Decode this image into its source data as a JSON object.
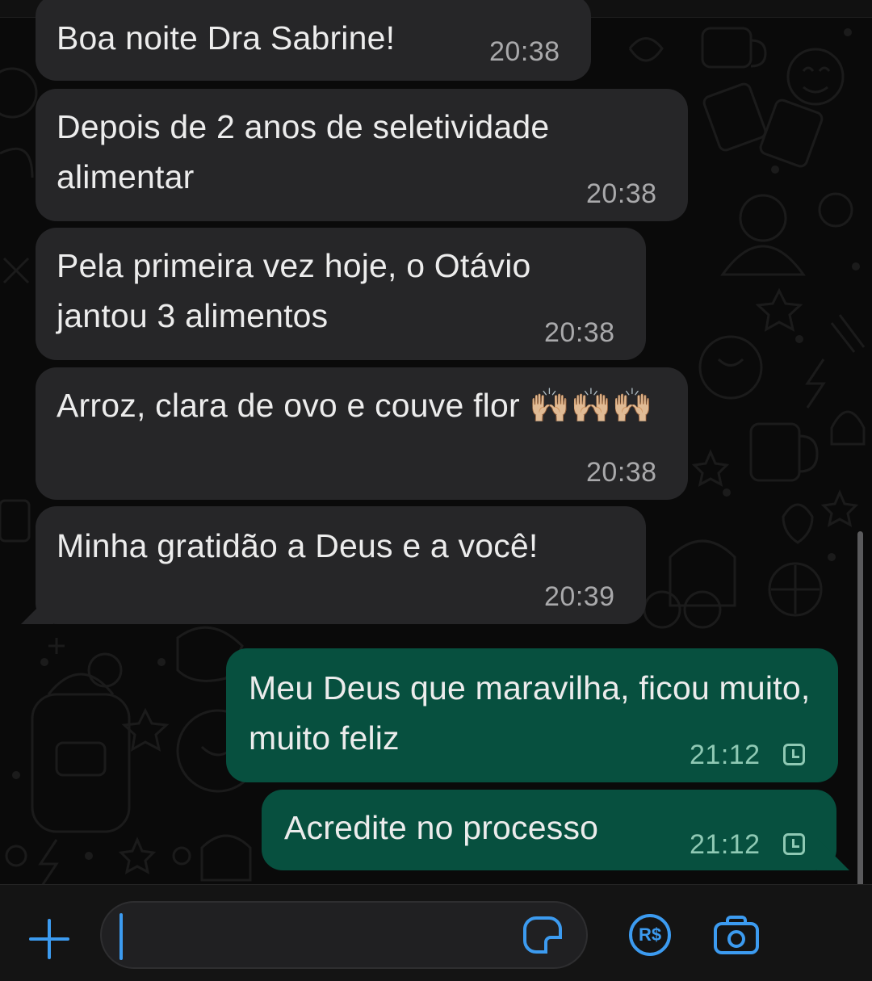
{
  "messages": [
    {
      "direction": "in",
      "text": "Boa noite Dra Sabrine!",
      "time": "20:38"
    },
    {
      "direction": "in",
      "text": "Depois de 2 anos de seletividade alimentar",
      "time": "20:38"
    },
    {
      "direction": "in",
      "text": "Pela primeira vez hoje, o Otávio jantou 3 alimentos",
      "time": "20:38"
    },
    {
      "direction": "in",
      "text": "Arroz, clara de ovo e couve flor 🙌🏼🙌🏼🙌🏼",
      "time": "20:38"
    },
    {
      "direction": "in",
      "text": "Minha gratidão a Deus e a você!",
      "time": "20:39"
    },
    {
      "direction": "out",
      "text": "Meu Deus que maravilha, ficou muito, muito feliz",
      "time": "21:12",
      "status_icon": "clock-pending-icon"
    },
    {
      "direction": "out",
      "text": "Acredite no processo",
      "time": "21:12",
      "status_icon": "clock-pending-icon"
    }
  ],
  "composer": {
    "input_value": "",
    "attach_icon": "plus-icon",
    "sticker_icon": "sticker-icon",
    "payment_label": "R$",
    "camera_icon": "camera-icon"
  },
  "colors": {
    "incoming_bubble": "#262628",
    "outgoing_bubble": "#07503f",
    "accent": "#3c9bf0"
  }
}
